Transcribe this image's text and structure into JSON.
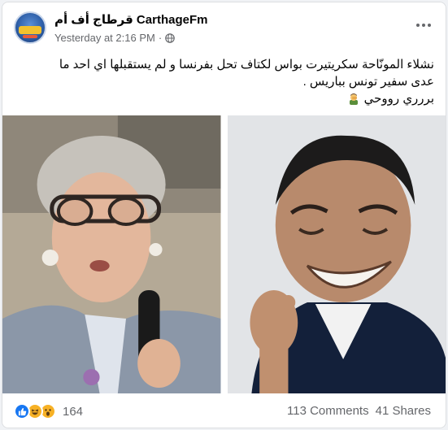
{
  "post": {
    "page_name": "قرطاج أف أم CarthageFm",
    "timestamp": "Yesterday at 2:16 PM",
    "separator": "·",
    "text_line1": "نشلاء المونّاحة سكريتيرت بواس لكتاف تحل بفرنسا و لم يستقبلها اي احد ما",
    "text_line2": "عدى سفير تونس بباريس .",
    "text_line3": "بررري رووحي",
    "icons": {
      "privacy": "globe-icon",
      "menu": "more-options-icon",
      "emoji": "man-facepalming-emoji"
    }
  },
  "engagement": {
    "reactions": [
      "like",
      "haha",
      "wow"
    ],
    "reaction_count": "164",
    "comments": "113 Comments",
    "shares": "41 Shares"
  },
  "colors": {
    "like": "#1877f2",
    "haha": "#f7b125",
    "secondary_text": "#65676b",
    "background": "#f0f2f5"
  }
}
